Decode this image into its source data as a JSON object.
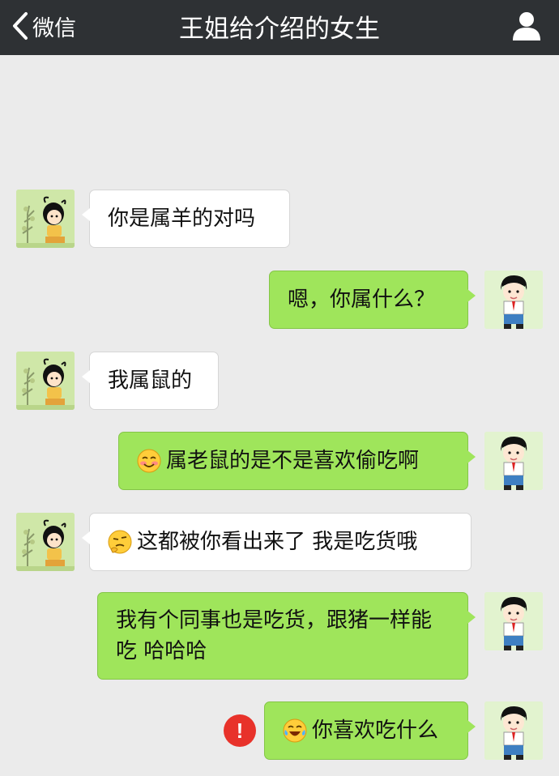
{
  "header": {
    "back_label": "微信",
    "title": "王姐给介绍的女生"
  },
  "messages": [
    {
      "side": "in",
      "text": "你是属羊的对吗"
    },
    {
      "side": "out",
      "text": "嗯，你属什么？"
    },
    {
      "side": "in",
      "text": "我属鼠的"
    },
    {
      "side": "out",
      "emoji": "smiling-face",
      "text": "属老鼠的是不是喜欢偷吃啊"
    },
    {
      "side": "in",
      "emoji": "thinking-face",
      "text": "这都被你看出来了 我是吃货哦"
    },
    {
      "side": "out",
      "text": "我有个同事也是吃货，跟猪一样能吃 哈哈哈"
    },
    {
      "side": "out",
      "emoji": "laughing-crying-face",
      "text": "你喜欢吃什么",
      "status": "failed"
    }
  ],
  "colors": {
    "header_bg": "#2e3134",
    "chat_bg": "#ebebeb",
    "incoming_bubble": "#ffffff",
    "outgoing_bubble": "#9fe55b",
    "error_badge": "#e8322a"
  }
}
